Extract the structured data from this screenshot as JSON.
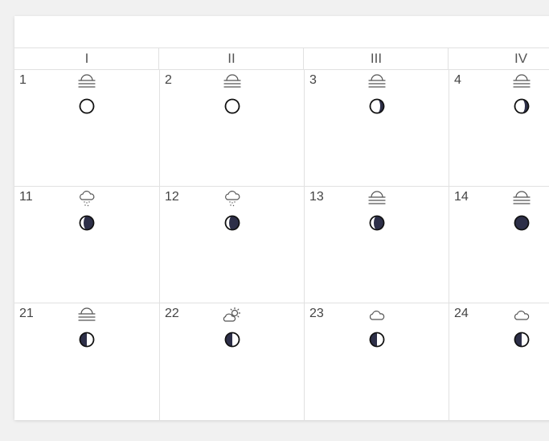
{
  "columns": [
    "I",
    "II",
    "III",
    "IV"
  ],
  "rows": [
    [
      {
        "day": "1",
        "weather": "fog",
        "moon": "new"
      },
      {
        "day": "2",
        "weather": "fog",
        "moon": "new"
      },
      {
        "day": "3",
        "weather": "fog",
        "moon": "waxing-crescent"
      },
      {
        "day": "4",
        "weather": "fog",
        "moon": "waxing-crescent"
      }
    ],
    [
      {
        "day": "11",
        "weather": "sleet",
        "moon": "waxing-gibbous"
      },
      {
        "day": "12",
        "weather": "sleet",
        "moon": "waxing-gibbous"
      },
      {
        "day": "13",
        "weather": "fog",
        "moon": "waxing-gibbous"
      },
      {
        "day": "14",
        "weather": "fog",
        "moon": "full"
      }
    ],
    [
      {
        "day": "21",
        "weather": "fog",
        "moon": "last-quarter"
      },
      {
        "day": "22",
        "weather": "partly-sunny",
        "moon": "last-quarter"
      },
      {
        "day": "23",
        "weather": "cloud",
        "moon": "last-quarter"
      },
      {
        "day": "24",
        "weather": "cloud",
        "moon": "last-quarter"
      }
    ]
  ],
  "colors": {
    "moon_dark": "#2d2f48",
    "moon_light": "#ffffff",
    "grid": "#e1e1e1",
    "background": "#f1f1f1"
  }
}
